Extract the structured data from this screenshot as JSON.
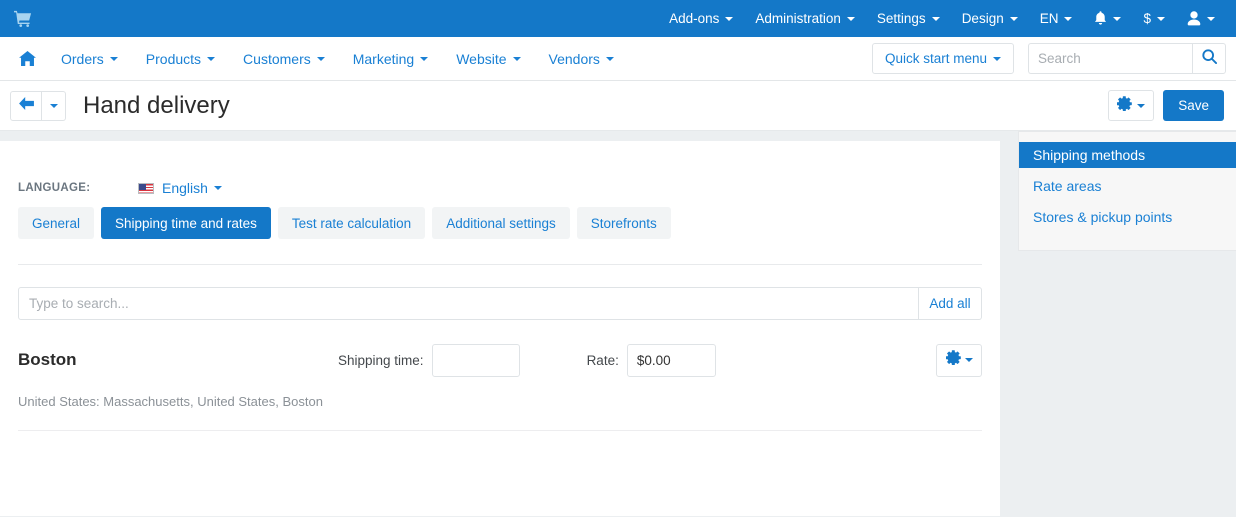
{
  "topbar": {
    "logo_icon": "shopping-cart-icon",
    "items": [
      {
        "label": "Add-ons",
        "caret": true
      },
      {
        "label": "Administration",
        "caret": true
      },
      {
        "label": "Settings",
        "caret": true
      },
      {
        "label": "Design",
        "caret": true
      },
      {
        "label": "EN",
        "caret": true
      }
    ],
    "icons": [
      {
        "name": "notifications-bell-icon",
        "caret": true
      },
      {
        "name": "currency-dollar-icon",
        "label": "$",
        "caret": true
      },
      {
        "name": "user-account-icon",
        "caret": true
      }
    ]
  },
  "mainnav": {
    "home_icon": "home-icon",
    "items": [
      {
        "label": "Orders"
      },
      {
        "label": "Products"
      },
      {
        "label": "Customers"
      },
      {
        "label": "Marketing"
      },
      {
        "label": "Website"
      },
      {
        "label": "Vendors"
      }
    ],
    "quick_start_label": "Quick start menu",
    "search_placeholder": "Search",
    "search_value": "",
    "search_icon": "search-icon"
  },
  "titlebar": {
    "back_icon": "arrow-left-icon",
    "title": "Hand delivery",
    "gear_icon": "gear-icon",
    "save_label": "Save"
  },
  "content": {
    "language_label": "LANGUAGE:",
    "language_value": "English",
    "language_flag": "us-flag-icon",
    "tabs": [
      {
        "label": "General",
        "active": false
      },
      {
        "label": "Shipping time and rates",
        "active": true
      },
      {
        "label": "Test rate calculation",
        "active": false
      },
      {
        "label": "Additional settings",
        "active": false
      },
      {
        "label": "Storefronts",
        "active": false
      }
    ],
    "search_placeholder": "Type to search...",
    "search_value": "",
    "add_all_label": "Add all",
    "rate_rows": [
      {
        "zone": "Boston",
        "shipping_time_label": "Shipping time:",
        "shipping_time_value": "",
        "rate_label": "Rate:",
        "rate_value": "$0.00",
        "subtitle": "United States: Massachusetts, United States, Boston"
      }
    ]
  },
  "sidebar": {
    "items": [
      {
        "label": "Shipping methods",
        "active": true
      },
      {
        "label": "Rate areas",
        "active": false
      },
      {
        "label": "Stores & pickup points",
        "active": false
      }
    ]
  },
  "colors": {
    "brand_blue": "#1478c8",
    "link_blue": "#1a80d4",
    "page_bg": "#eceff1",
    "panel_bg": "#ffffff",
    "sidebar_bg": "#f7f7f7"
  }
}
